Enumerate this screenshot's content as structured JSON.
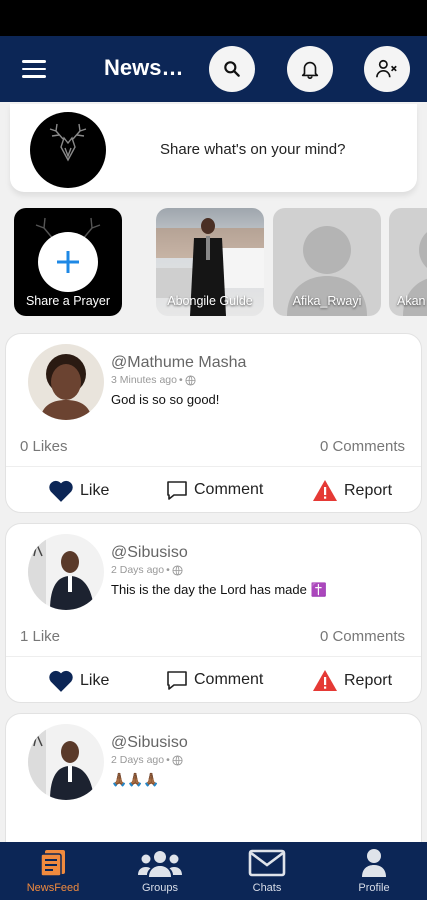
{
  "header": {
    "title": "NewsFeed",
    "icons": [
      "menu-icon",
      "search-icon",
      "bell-icon",
      "user-remove-icon"
    ]
  },
  "share": {
    "prompt": "Share what's on your mind?"
  },
  "stories": [
    {
      "label": "Share a Prayer",
      "kind": "add"
    },
    {
      "label": "Abongile Gulde",
      "kind": "photo"
    },
    {
      "label": "Afika_Rwayi",
      "kind": "placeholder"
    },
    {
      "label": "Akan",
      "kind": "placeholder"
    }
  ],
  "posts": [
    {
      "username": "@Mathume Masha",
      "time": "3 Minutes ago",
      "text": "God is so so good!",
      "likes": "0 Likes",
      "comments": "0 Comments"
    },
    {
      "username": "@Sibusiso",
      "time": "2 Days ago",
      "text": "This is the day the Lord has made ✝️",
      "likes": "1 Like",
      "comments": "0 Comments"
    },
    {
      "username": "@Sibusiso",
      "time": "2 Days ago",
      "text": "🙏🏾🙏🏾🙏🏾"
    }
  ],
  "actions": {
    "like": "Like",
    "comment": "Comment",
    "report": "Report"
  },
  "nav": [
    {
      "label": "NewsFeed",
      "icon": "newsfeed-icon",
      "active": true
    },
    {
      "label": "Groups",
      "icon": "groups-icon",
      "active": false
    },
    {
      "label": "Chats",
      "icon": "chats-icon",
      "active": false
    },
    {
      "label": "Profile",
      "icon": "profile-icon",
      "active": false
    }
  ],
  "colors": {
    "primary": "#0c2656",
    "accent": "#f08a3e",
    "heart": "#0c2656",
    "report": "#e53935",
    "story_add": "#1e88e5"
  }
}
